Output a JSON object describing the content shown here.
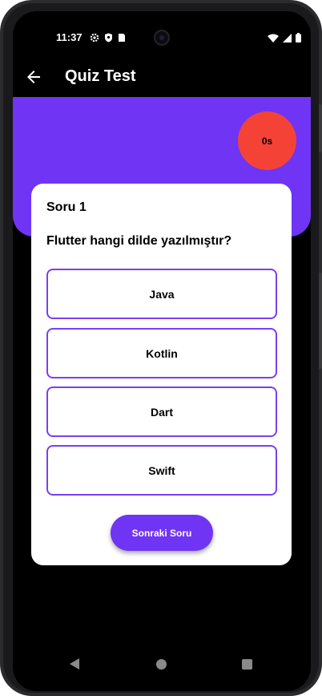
{
  "status_bar": {
    "time": "11:37",
    "left_icons": [
      "gear-icon",
      "shield-icon",
      "sim-card-icon"
    ],
    "right_icons": [
      "wifi-icon",
      "signal-icon",
      "battery-icon"
    ]
  },
  "app_bar": {
    "title": "Quiz Test"
  },
  "timer": {
    "label": "0s"
  },
  "question": {
    "number_label": "Soru 1",
    "text": "Flutter hangi dilde yazılmıştır?",
    "options": [
      "Java",
      "Kotlin",
      "Dart",
      "Swift"
    ]
  },
  "next_button": {
    "label": "Sonraki Soru"
  },
  "colors": {
    "accent": "#7034f4",
    "option_border": "#7a3ff0",
    "timer": "#f44336",
    "card": "#ffffff",
    "background": "#000000"
  }
}
